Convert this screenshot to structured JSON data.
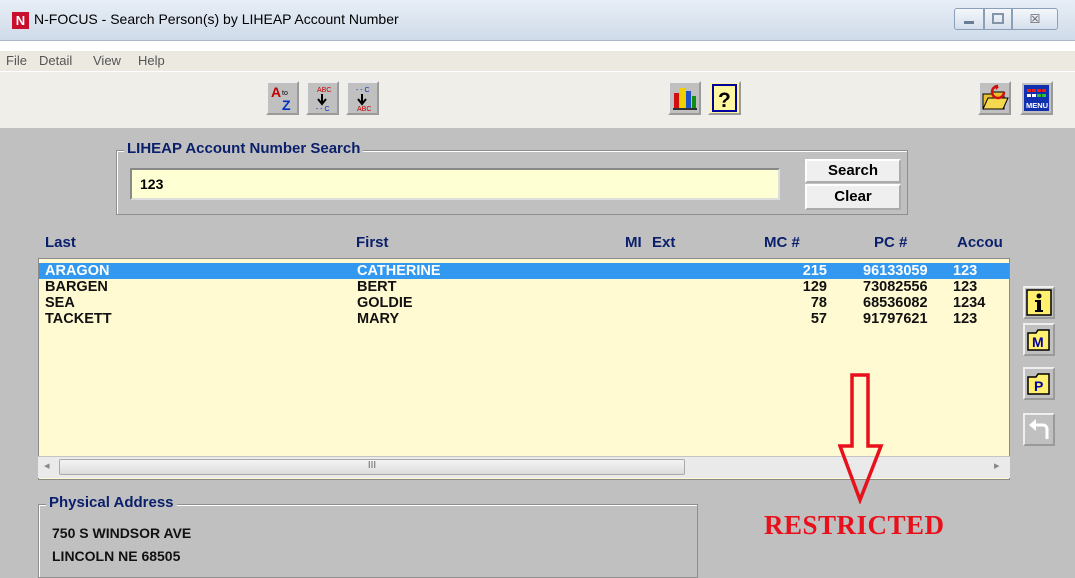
{
  "window": {
    "app_icon": "N",
    "title": "N-FOCUS - Search Person(s) by LIHEAP Account Number",
    "controls": [
      "minimize-icon",
      "maximize-icon",
      "close-icon"
    ],
    "close_glyph": "☒"
  },
  "menu": [
    "File",
    "Detail",
    "View",
    "Help"
  ],
  "toolbar": {
    "buttons": [
      "sort-a-to-z-icon",
      "sort-ascending-icon",
      "sort-descending-icon",
      "bar-chart-icon",
      "help-icon",
      "open-folder-icon",
      "menu-icon"
    ],
    "help_glyph": "?",
    "menu_label": "MENU"
  },
  "search": {
    "legend": "LIHEAP Account Number Search",
    "value": "123",
    "search_label": "Search",
    "clear_label": "Clear"
  },
  "columns": [
    "Last",
    "First",
    "MI",
    "Ext",
    "MC #",
    "PC #",
    "Accou"
  ],
  "rows": [
    {
      "last": "ARAGON",
      "first": "CATHERINE",
      "mc": "215",
      "pc": "96133059",
      "acct": "123",
      "selected": true
    },
    {
      "last": "BARGEN",
      "first": "BERT",
      "mc": "129",
      "pc": "73082556",
      "acct": "123",
      "selected": false
    },
    {
      "last": "SEA",
      "first": "GOLDIE",
      "mc": "78",
      "pc": "68536082",
      "acct": "1234",
      "selected": false
    },
    {
      "last": "TACKETT",
      "first": "MARY",
      "mc": "57",
      "pc": "91797621",
      "acct": "123",
      "selected": false
    }
  ],
  "scrollbar": {
    "left_arrow": "◂",
    "right_arrow": "▸",
    "thumb_grip": "III"
  },
  "side_buttons": {
    "icons": [
      "person-info-icon",
      "m-icon",
      "p-icon",
      "return-icon"
    ],
    "m_label": "M",
    "p_label": "P"
  },
  "address": {
    "legend": "Physical Address",
    "line1": "750 S WINDSOR AVE",
    "line2": "LINCOLN NE  68505"
  },
  "annotation": {
    "label": "RESTRICTED",
    "arrow_icon": "down-arrow-icon",
    "color": "#e8101b"
  },
  "colors": {
    "selection": "#3399f0",
    "grid_background": "#fffad2",
    "heading_navy": "#0a1f6b"
  }
}
